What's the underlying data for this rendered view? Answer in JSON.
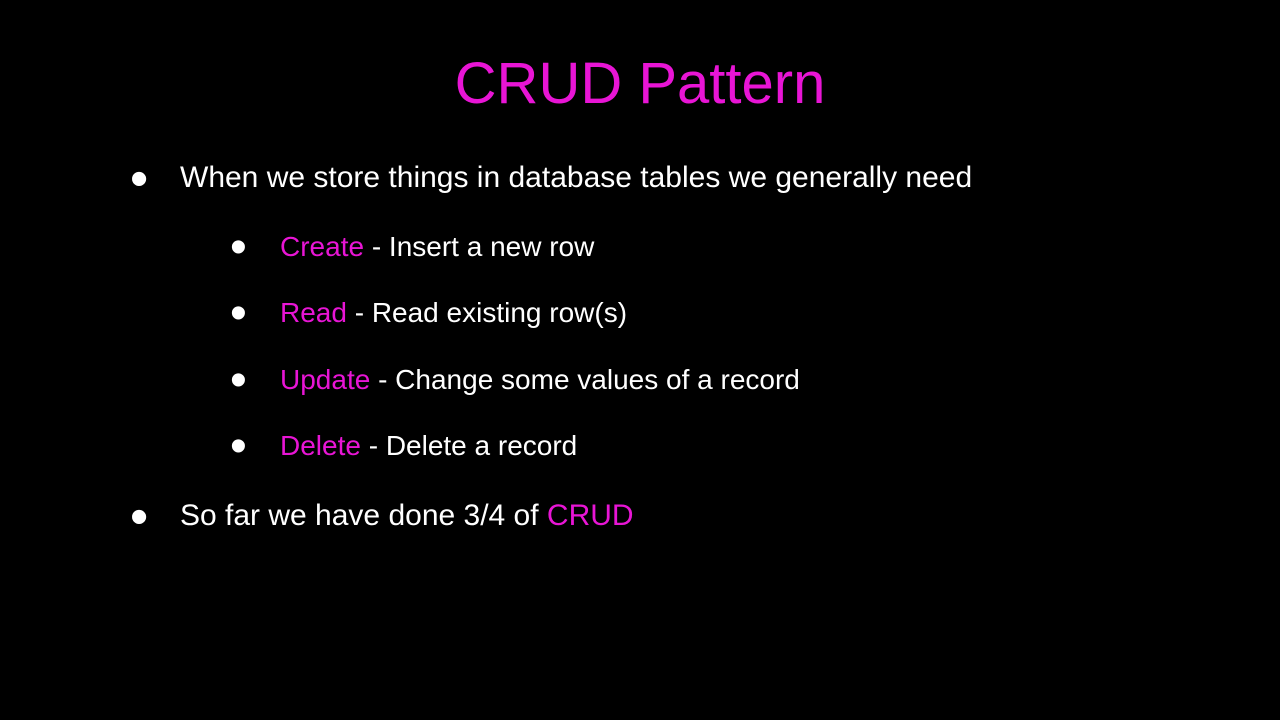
{
  "title": "CRUD Pattern",
  "bullets": {
    "intro": "When we store things in database tables we generally need",
    "subitems": [
      {
        "term": "Create",
        "desc": " - Insert a new row"
      },
      {
        "term": "Read",
        "desc": " - Read existing row(s)"
      },
      {
        "term": "Update",
        "desc": " - Change some values of a record"
      },
      {
        "term": "Delete",
        "desc": " - Delete a record"
      }
    ],
    "conclusion_prefix": "So far we have done 3/4 of ",
    "conclusion_highlight": "CRUD"
  },
  "colors": {
    "background": "#000000",
    "text": "#ffffff",
    "accent": "#e815d5"
  }
}
